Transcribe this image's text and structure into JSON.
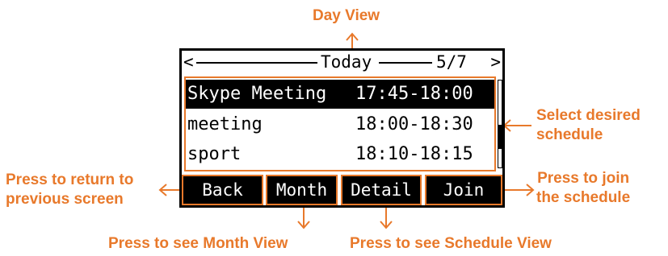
{
  "screen": {
    "header": {
      "left_arrow": "<",
      "title": "Today",
      "page": "5/7",
      "right_arrow": ">"
    },
    "schedules": [
      {
        "name": "Skype Meeting",
        "time": "17:45-18:00",
        "selected": true
      },
      {
        "name": "meeting",
        "time": "18:00-18:30",
        "selected": false
      },
      {
        "name": "sport",
        "time": "18:10-18:15",
        "selected": false
      }
    ],
    "scroll_position": 0.7,
    "softkeys": [
      "Back",
      "Month",
      "Detail",
      "Join"
    ]
  },
  "annotations": {
    "day_view": "Day View",
    "select": [
      "Select desired",
      "schedule"
    ],
    "return": [
      "Press to return to",
      "previous screen"
    ],
    "join": [
      "Press to join",
      "the schedule"
    ],
    "month": "Press to see Month View",
    "schedule": "Press to see Schedule View"
  },
  "colors": {
    "accent": "#e8792b",
    "screen_bg": "#ffffff",
    "text": "#000000"
  }
}
